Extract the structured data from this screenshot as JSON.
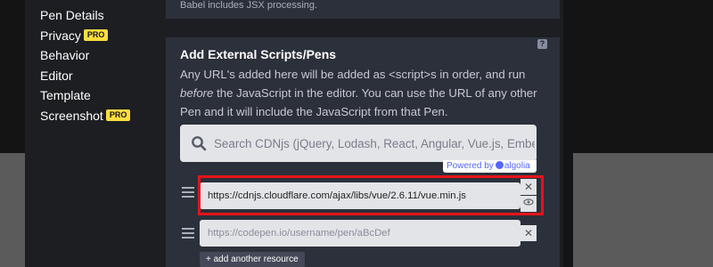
{
  "sidebar": {
    "items": [
      {
        "label": "Pen Details",
        "pro": ""
      },
      {
        "label": "Privacy",
        "pro": "PRO"
      },
      {
        "label": "Behavior",
        "pro": ""
      },
      {
        "label": "Editor",
        "pro": ""
      },
      {
        "label": "Template",
        "pro": ""
      },
      {
        "label": "Screenshot",
        "pro": "PRO"
      }
    ]
  },
  "upper_panel": {
    "note": "Babel includes JSX processing."
  },
  "panel": {
    "help": "?",
    "title": "Add External Scripts/Pens",
    "desc_1": "Any URL's added here will be added as <script>s in order, and run",
    "desc_em": "before",
    "desc_2": " the JavaScript in the editor. You can use the URL of any other Pen and it will include the JavaScript from that Pen."
  },
  "search": {
    "placeholder": "Search CDNjs (jQuery, Lodash, React, Angular, Vue.js, Ember.",
    "value": ""
  },
  "powered_by": {
    "text": "Powered by",
    "brand": "algolia"
  },
  "resources": [
    {
      "value": "https://cdnjs.cloudflare.com/ajax/libs/vue/2.6.11/vue.min.js",
      "placeholder": ""
    },
    {
      "value": "",
      "placeholder": "https://codepen.io/username/pen/aBcDef"
    }
  ],
  "add_resource_label": "+ add another resource",
  "colors": {
    "pro_badge": "#ffdd40",
    "highlight": "#e6131a",
    "algolia": "#5468ff"
  }
}
